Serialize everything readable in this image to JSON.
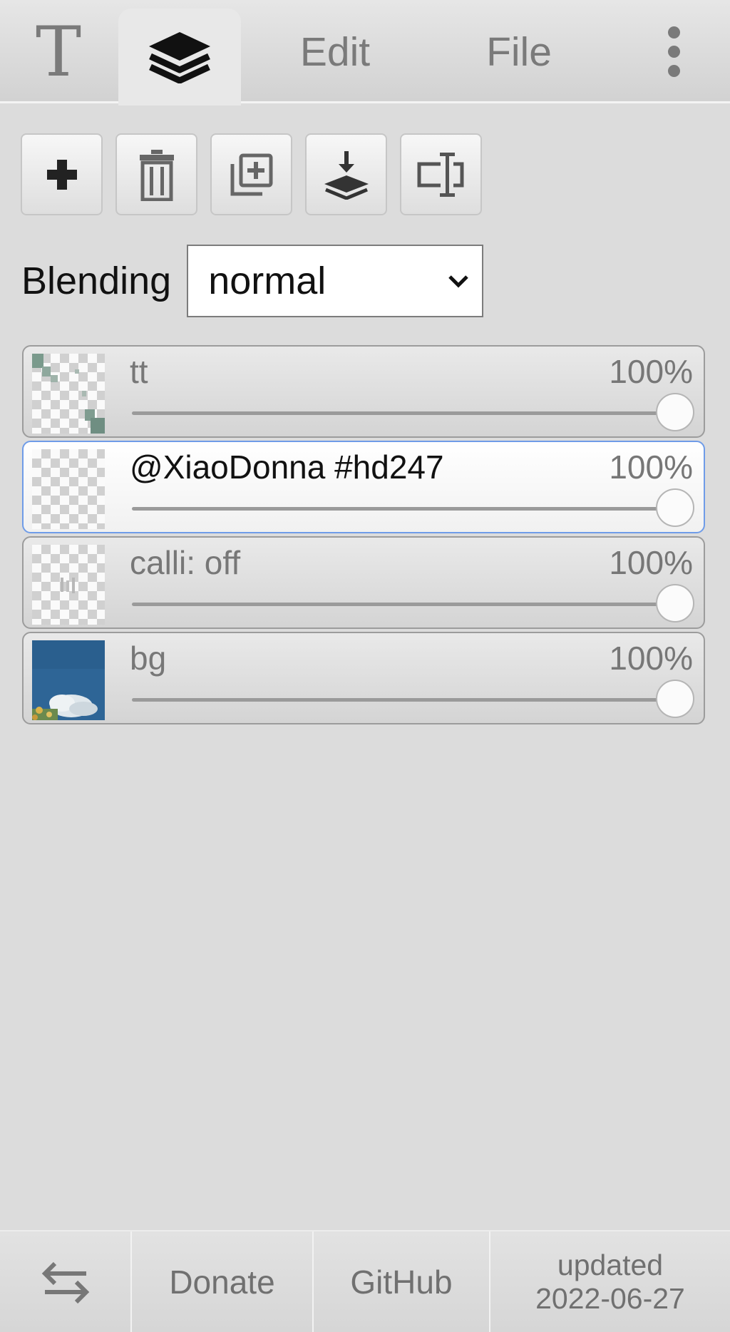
{
  "tabs": {
    "text_icon_glyph": "T",
    "edit_label": "Edit",
    "file_label": "File"
  },
  "toolbar": {
    "icons": [
      "plus-icon",
      "trash-icon",
      "duplicate-icon",
      "merge-down-icon",
      "rename-icon"
    ]
  },
  "blending": {
    "label": "Blending",
    "selected": "normal"
  },
  "layers": [
    {
      "name": "tt",
      "opacity_label": "100%",
      "opacity": 1.0,
      "selected": false
    },
    {
      "name": "@XiaoDonna #hd247",
      "opacity_label": "100%",
      "opacity": 1.0,
      "selected": true
    },
    {
      "name": "calli: off",
      "opacity_label": "100%",
      "opacity": 1.0,
      "selected": false
    },
    {
      "name": "bg",
      "opacity_label": "100%",
      "opacity": 1.0,
      "selected": false
    }
  ],
  "footer": {
    "donate_label": "Donate",
    "github_label": "GitHub",
    "updated_line1": "updated",
    "updated_line2": "2022-06-27"
  },
  "colors": {
    "selected_border": "#6f9ce8",
    "panel_bg": "#dcdcdc"
  }
}
